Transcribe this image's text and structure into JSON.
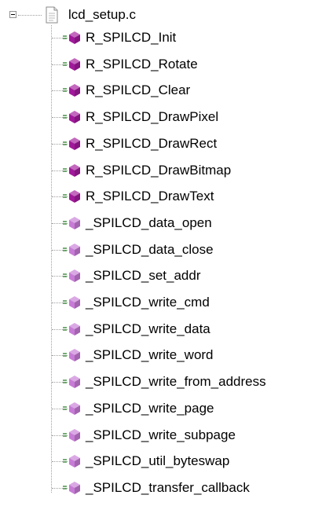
{
  "tree": {
    "file_label": "lcd_setup.c",
    "items": [
      {
        "label": "R_SPILCD_Init",
        "icon": "public-function-icon"
      },
      {
        "label": "R_SPILCD_Rotate",
        "icon": "public-function-icon"
      },
      {
        "label": "R_SPILCD_Clear",
        "icon": "public-function-icon"
      },
      {
        "label": "R_SPILCD_DrawPixel",
        "icon": "public-function-icon"
      },
      {
        "label": "R_SPILCD_DrawRect",
        "icon": "public-function-icon"
      },
      {
        "label": "R_SPILCD_DrawBitmap",
        "icon": "public-function-icon"
      },
      {
        "label": "R_SPILCD_DrawText",
        "icon": "public-function-icon"
      },
      {
        "label": "_SPILCD_data_open",
        "icon": "static-function-icon"
      },
      {
        "label": "_SPILCD_data_close",
        "icon": "static-function-icon"
      },
      {
        "label": "_SPILCD_set_addr",
        "icon": "static-function-icon"
      },
      {
        "label": "_SPILCD_write_cmd",
        "icon": "static-function-icon"
      },
      {
        "label": "_SPILCD_write_data",
        "icon": "static-function-icon"
      },
      {
        "label": "_SPILCD_write_word",
        "icon": "static-function-icon"
      },
      {
        "label": "_SPILCD_write_from_address",
        "icon": "static-function-icon"
      },
      {
        "label": "_SPILCD_write_page",
        "icon": "static-function-icon"
      },
      {
        "label": "_SPILCD_write_subpage",
        "icon": "static-function-icon"
      },
      {
        "label": "_SPILCD_util_byteswap",
        "icon": "static-function-icon"
      },
      {
        "label": "_SPILCD_transfer_callback",
        "icon": "static-function-icon"
      }
    ]
  },
  "colors": {
    "public_function": "#a1199b",
    "static_function": "#c77bd6",
    "tree_line": "#a0a0a0"
  }
}
